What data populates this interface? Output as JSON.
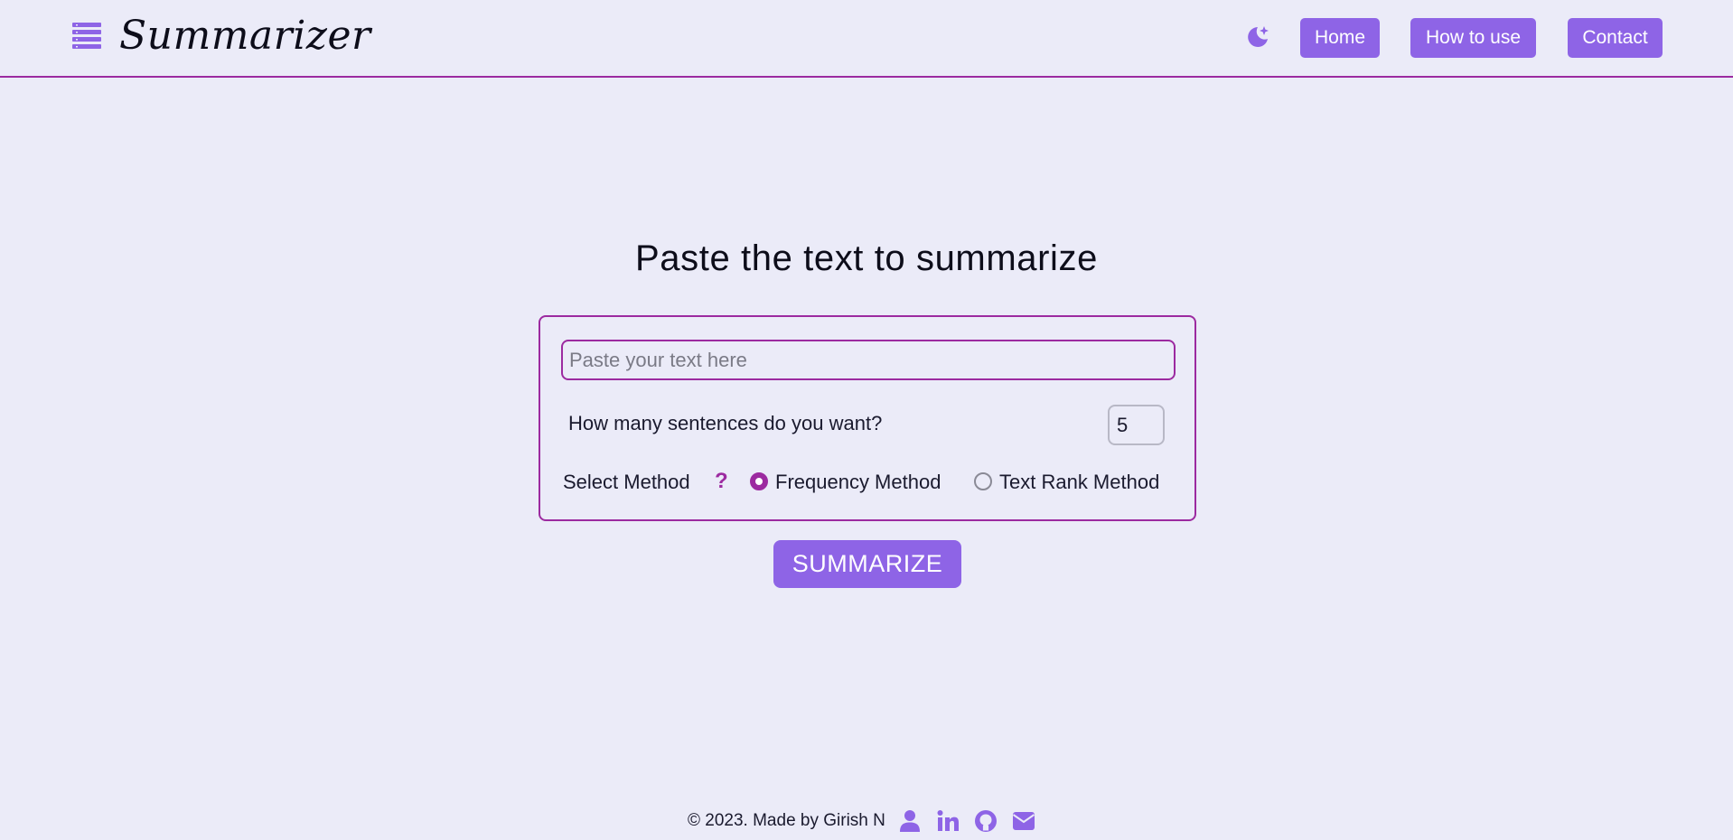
{
  "brand": {
    "title": "Summarizer",
    "icon": "list-icon"
  },
  "nav": {
    "theme_icon": "moon-icon",
    "items": [
      {
        "label": "Home"
      },
      {
        "label": "How to use"
      },
      {
        "label": "Contact"
      }
    ]
  },
  "main": {
    "heading": "Paste the text to summarize",
    "text_input": {
      "placeholder": "Paste your text here",
      "value": ""
    },
    "sentences": {
      "label": "How many sentences do you want?",
      "value": "5"
    },
    "method": {
      "label": "Select Method",
      "help": "?",
      "options": [
        {
          "label": "Frequency Method",
          "selected": true
        },
        {
          "label": "Text Rank Method",
          "selected": false
        }
      ]
    },
    "submit_label": "SUMMARIZE"
  },
  "footer": {
    "copyright": "© 2023. Made by Girish N",
    "icons": [
      "user-icon",
      "linkedin-icon",
      "github-icon",
      "envelope-icon"
    ]
  },
  "colors": {
    "background": "#ebebf8",
    "accent": "#8e64e6",
    "border": "#9c2aa0",
    "text": "#1a1a2e"
  }
}
